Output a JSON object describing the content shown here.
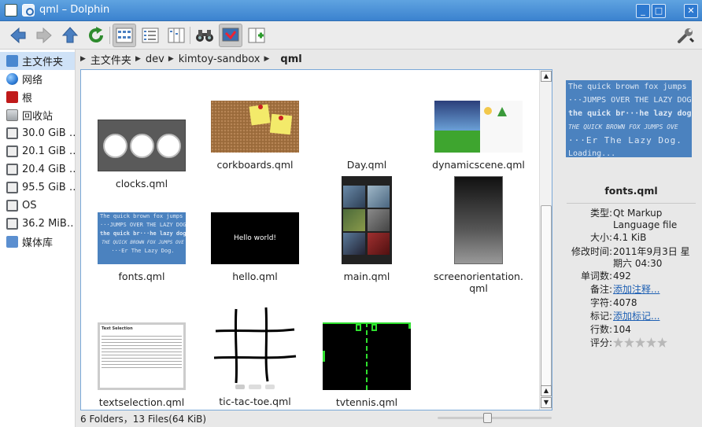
{
  "window": {
    "title": "qml – Dolphin",
    "min": "_",
    "max": "□",
    "close": "✕"
  },
  "toolbar": {
    "buttons": [
      {
        "name": "back-button",
        "icon": "arrow-left-icon"
      },
      {
        "name": "forward-button",
        "icon": "arrow-right-icon"
      },
      {
        "name": "up-button",
        "icon": "arrow-up-icon"
      },
      {
        "name": "reload-button",
        "icon": "reload-icon"
      },
      {
        "name": "icons-view-button",
        "icon": "icons-view-icon"
      },
      {
        "name": "details-view-button",
        "icon": "details-view-icon"
      },
      {
        "name": "columns-view-button",
        "icon": "columns-view-icon"
      },
      {
        "name": "find-button",
        "icon": "binoculars-icon"
      },
      {
        "name": "preview-button",
        "icon": "preview-icon"
      },
      {
        "name": "split-button",
        "icon": "split-icon"
      },
      {
        "name": "configure-button",
        "icon": "wrench-icon"
      }
    ]
  },
  "places": [
    {
      "label": "主文件夹",
      "icon": "home-icon",
      "color": "#4a88d0",
      "selected": true
    },
    {
      "label": "网络",
      "icon": "globe-icon",
      "color": "#2d7bd6"
    },
    {
      "label": "根",
      "icon": "root-folder-icon",
      "color": "#c01a1a"
    },
    {
      "label": "回收站",
      "icon": "trash-icon",
      "color": "#9ea3a8"
    },
    {
      "label": "30.0 GiB …",
      "icon": "drive-icon",
      "color": "#5f6368"
    },
    {
      "label": "20.1 GiB …",
      "icon": "drive-icon",
      "color": "#5f6368"
    },
    {
      "label": "20.4 GiB …",
      "icon": "drive-icon",
      "color": "#5f6368"
    },
    {
      "label": "95.5 GiB …",
      "icon": "drive-icon",
      "color": "#5f6368"
    },
    {
      "label": "OS",
      "icon": "drive-icon",
      "color": "#5f6368"
    },
    {
      "label": "36.2 MiB…",
      "icon": "drive-icon",
      "color": "#5f6368"
    },
    {
      "label": "媒体库",
      "icon": "folder-icon",
      "color": "#5b8fd0"
    }
  ],
  "breadcrumb": [
    {
      "label": "主文件夹"
    },
    {
      "label": "dev"
    },
    {
      "label": "kimtoy-sandbox"
    },
    {
      "label": "qml",
      "current": true
    }
  ],
  "files": [
    {
      "label": "clocks.qml",
      "thumb": "clocks"
    },
    {
      "label": "corkboards.qml",
      "thumb": "corkboard"
    },
    {
      "label": "Day.qml",
      "thumb": "blank"
    },
    {
      "label": "dynamicscene.qml",
      "thumb": "dynamic"
    },
    {
      "label": "fonts.qml",
      "thumb": "fonts"
    },
    {
      "label": "hello.qml",
      "thumb": "hello",
      "text": "Hello world!"
    },
    {
      "label": "main.qml",
      "thumb": "main"
    },
    {
      "label": "screenorientation.\nqml",
      "thumb": "screen"
    },
    {
      "label": "textselection.qml",
      "thumb": "textsel",
      "text": "Text Selection"
    },
    {
      "label": "tic-tac-toe.qml",
      "thumb": "tictac"
    },
    {
      "label": "tvtennis.qml",
      "thumb": "tvtennis"
    }
  ],
  "status": {
    "summary": "6 Folders，13 Files(64 KiB)"
  },
  "info": {
    "preview_lines": [
      "The quick brown fox jumps ov…",
      "···JUMPS OVER THE LAZY DOG.",
      "the quick br···he lazy dog.",
      "THE QUICK BROWN FOX JUMPS OVE",
      "···Er The Lazy Dog.",
      "Loading..."
    ],
    "filename": "fonts.qml",
    "props": [
      {
        "k": "类型:",
        "v": "Qt Markup Language file"
      },
      {
        "k": "大小:",
        "v": "4.1 KiB"
      },
      {
        "k": "修改时间:",
        "v": "2011年9月3日 星期六 04:30"
      },
      {
        "k": "单词数:",
        "v": "492"
      },
      {
        "k": "备注:",
        "v": "添加注释...",
        "link": true
      },
      {
        "k": "字符:",
        "v": "4078"
      },
      {
        "k": "标记:",
        "v": "添加标记...",
        "link": true
      },
      {
        "k": "行数:",
        "v": "104"
      },
      {
        "k": "评分:",
        "v": ""
      }
    ],
    "rating": 0
  },
  "colors": {
    "accent": "#3b82cf",
    "selection": "#cfe2f7",
    "link": "#1d5fb3"
  }
}
